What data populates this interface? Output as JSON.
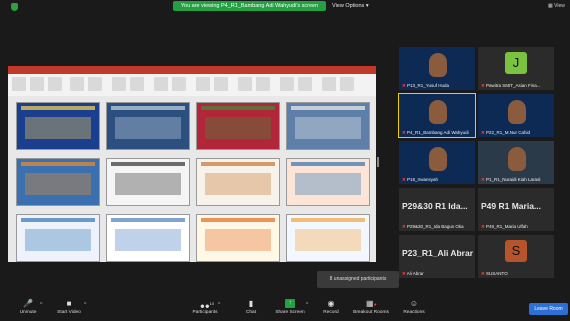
{
  "top_bar": {
    "banner": "You are viewing P4_R1_Bambang Adi Wahyudi's screen",
    "view_options": "View Options",
    "view_label": "View"
  },
  "gallery": [
    {
      "name": "P13_R1_Yusuf Huda",
      "type": "video",
      "bg": "#0d2a55"
    },
    {
      "name": "Pawitra SMIT_Asian Fina...",
      "type": "avatar",
      "letter": "J",
      "color": "#7cc241"
    },
    {
      "name": "P4_R1_Bambang Adi Wahyudi",
      "type": "video",
      "bg": "#0d2a55",
      "active": true
    },
    {
      "name": "P22_R1_M.Nur Cahid",
      "type": "video",
      "bg": "#0d2a55"
    },
    {
      "name": "P18_Irwansyah",
      "type": "video",
      "bg": "#0d2a55"
    },
    {
      "name": "P1_R1_Nuraidi Kiah Larasl",
      "type": "video",
      "bg": "#2a3a48"
    },
    {
      "name": "P29&30 R1 Ida...",
      "sub": "P29&30_R1_Ida Bagus Oka",
      "type": "name"
    },
    {
      "name": "P49 R1 Maria...",
      "sub": "P49_R1_Maria Ulfah",
      "type": "name"
    },
    {
      "name": "P23_R1_Ali Abrar",
      "sub": "Ali Abrar",
      "type": "name"
    },
    {
      "name": "SUSANTO",
      "type": "avatar",
      "letter": "S",
      "color": "#b7542d"
    }
  ],
  "unassigned": "8 unassigned participants",
  "toolbar": {
    "unmute": "Unmute",
    "start_video": "Start Video",
    "participants": "Participants",
    "participants_count": "10",
    "chat": "Chat",
    "share_screen": "Share Screen",
    "record": "Record",
    "breakout_rooms": "Breakout Rooms",
    "reactions": "Reactions",
    "leave": "Leave Room"
  },
  "colors": {
    "banner": "#23a042",
    "leave": "#2d6fd6",
    "share": "#23a042",
    "active_outline": "#f0d000"
  },
  "slides": [
    {
      "bg": "#1b3f8f",
      "accent": "#ffd54f"
    },
    {
      "bg": "#2b4f7e",
      "accent": "#c9d6e8"
    },
    {
      "bg": "#b3263a",
      "accent": "#3a8f3a"
    },
    {
      "bg": "#5e7fa8",
      "accent": "#f0f0f0"
    },
    {
      "bg": "#3a6fb0",
      "accent": "#f28c28"
    },
    {
      "bg": "#f5f5f5",
      "accent": "#333333"
    },
    {
      "bg": "#f7f3ea",
      "accent": "#c87533"
    },
    {
      "bg": "#fce4d6",
      "accent": "#2f75b5"
    },
    {
      "bg": "#eef3fb",
      "accent": "#2f75b5"
    },
    {
      "bg": "#ffffff",
      "accent": "#4a7cc2"
    },
    {
      "bg": "#fff8e6",
      "accent": "#e26b1f"
    },
    {
      "bg": "#f3f7ff",
      "accent": "#f2a33a"
    }
  ]
}
